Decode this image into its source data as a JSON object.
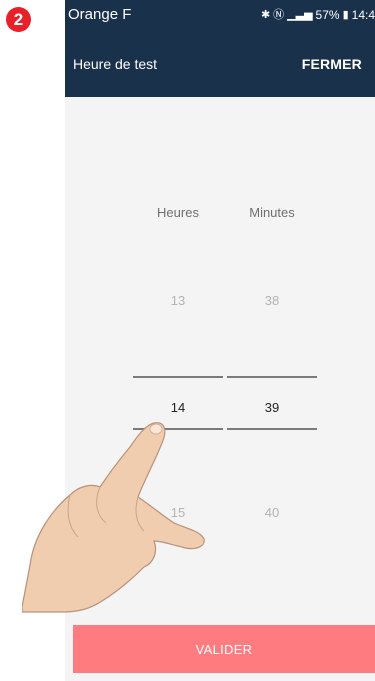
{
  "step_badge": "2",
  "status_bar": {
    "carrier": "Orange F",
    "bluetooth_icon": "bluetooth-icon",
    "nfc_icon": "nfc-icon",
    "signal_icon": "signal-icon",
    "battery": "57%",
    "battery_icon": "battery-icon",
    "time": "14:4"
  },
  "app_bar": {
    "title": "Heure de test",
    "close_label": "FERMER"
  },
  "picker": {
    "hours_label": "Heures",
    "minutes_label": "Minutes",
    "hours_prev": "13",
    "hours_selected": "14",
    "hours_next": "15",
    "minutes_prev": "38",
    "minutes_selected": "39",
    "minutes_next": "40"
  },
  "validate_label": "VALIDER",
  "colors": {
    "header_bg": "#19314b",
    "accent_button": "#fe7b80",
    "badge": "#e8202a"
  }
}
